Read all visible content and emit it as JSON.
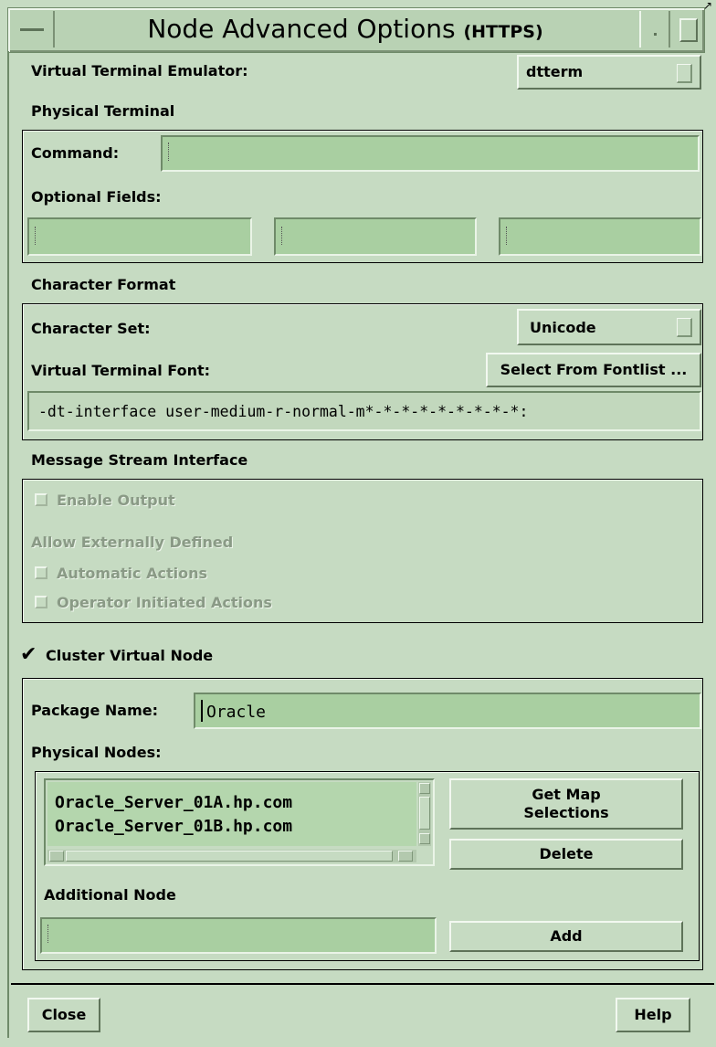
{
  "window": {
    "title": "Node Advanced Options",
    "title_suffix": "(HTTPS)"
  },
  "vte": {
    "label": "Virtual Terminal Emulator:",
    "value": "dtterm"
  },
  "physical_terminal": {
    "heading": "Physical Terminal",
    "command_label": "Command:",
    "command_value": "",
    "optional_label": "Optional Fields:",
    "optional_values": [
      "",
      "",
      ""
    ]
  },
  "character_format": {
    "heading": "Character Format",
    "charset_label": "Character Set:",
    "charset_value": "Unicode",
    "font_label": "Virtual Terminal Font:",
    "font_button": "Select From Fontlist ...",
    "font_value": "-dt-interface user-medium-r-normal-m*-*-*-*-*-*-*-*-*:"
  },
  "msi": {
    "heading": "Message Stream Interface",
    "enable_output": "Enable Output",
    "allow_label": "Allow Externally Defined",
    "automatic_actions": "Automatic Actions",
    "operator_actions": "Operator Initiated Actions"
  },
  "cluster": {
    "checkbox_label": "Cluster Virtual Node",
    "checked": true,
    "package_label": "Package Name:",
    "package_value": "Oracle",
    "physical_nodes_label": "Physical Nodes:",
    "nodes": [
      "Oracle_Server_01A.hp.com",
      "Oracle_Server_01B.hp.com"
    ],
    "get_map_button": "Get Map Selections",
    "delete_button": "Delete",
    "additional_label": "Additional Node",
    "additional_value": "",
    "add_button": "Add"
  },
  "footer": {
    "close_button": "Close",
    "help_button": "Help"
  },
  "colors": {
    "background": "#c6dbc2",
    "field": "#a9cfa1",
    "list": "#b4d6ad"
  }
}
